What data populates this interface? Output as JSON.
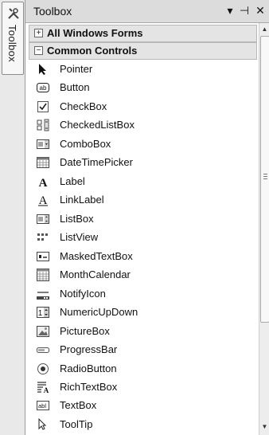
{
  "window": {
    "strip_label": "Toolbox",
    "title": "Toolbox",
    "pin_glyph": "▾",
    "dock_glyph": "⊣",
    "close_glyph": "✕"
  },
  "categories": [
    {
      "label": "All Windows Forms",
      "expanded": false,
      "toggle": "+"
    },
    {
      "label": "Common Controls",
      "expanded": true,
      "toggle": "−"
    }
  ],
  "items": [
    {
      "label": "Pointer",
      "icon": "pointer-icon"
    },
    {
      "label": "Button",
      "icon": "button-icon"
    },
    {
      "label": "CheckBox",
      "icon": "checkbox-icon"
    },
    {
      "label": "CheckedListBox",
      "icon": "checkedlistbox-icon"
    },
    {
      "label": "ComboBox",
      "icon": "combobox-icon"
    },
    {
      "label": "DateTimePicker",
      "icon": "datetimepicker-icon"
    },
    {
      "label": "Label",
      "icon": "label-icon"
    },
    {
      "label": "LinkLabel",
      "icon": "linklabel-icon"
    },
    {
      "label": "ListBox",
      "icon": "listbox-icon"
    },
    {
      "label": "ListView",
      "icon": "listview-icon"
    },
    {
      "label": "MaskedTextBox",
      "icon": "maskedtextbox-icon"
    },
    {
      "label": "MonthCalendar",
      "icon": "monthcalendar-icon"
    },
    {
      "label": "NotifyIcon",
      "icon": "notifyicon-icon"
    },
    {
      "label": "NumericUpDown",
      "icon": "numericupdown-icon"
    },
    {
      "label": "PictureBox",
      "icon": "picturebox-icon"
    },
    {
      "label": "ProgressBar",
      "icon": "progressbar-icon"
    },
    {
      "label": "RadioButton",
      "icon": "radiobutton-icon"
    },
    {
      "label": "RichTextBox",
      "icon": "richtextbox-icon"
    },
    {
      "label": "TextBox",
      "icon": "textbox-icon"
    },
    {
      "label": "ToolTip",
      "icon": "tooltip-icon"
    }
  ]
}
